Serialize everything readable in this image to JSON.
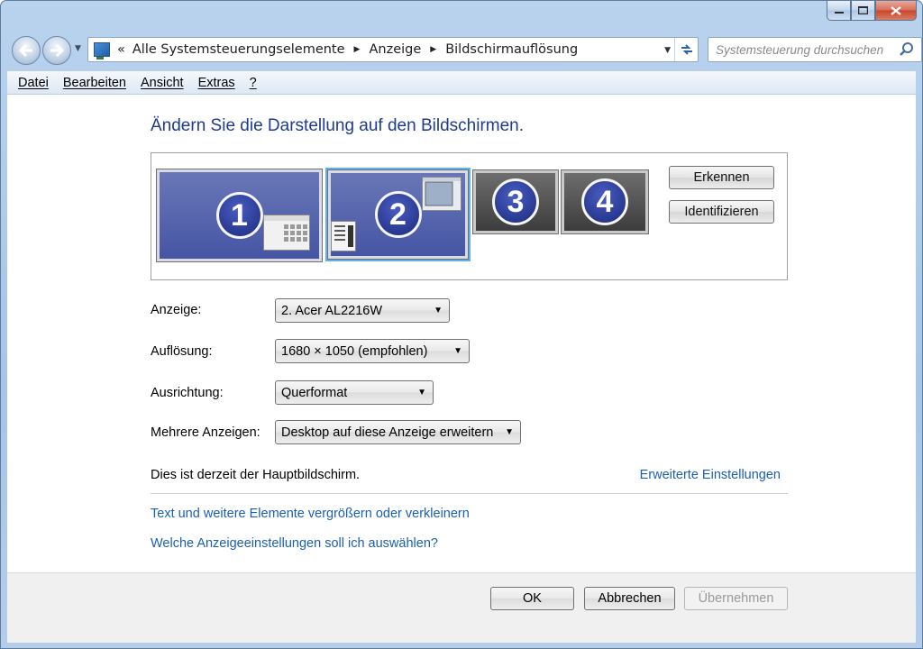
{
  "window": {
    "caption_buttons": [
      "minimize-icon",
      "maximize-icon",
      "close-icon"
    ]
  },
  "nav": {
    "breadcrumb_prefix": "«",
    "breadcrumb": [
      "Alle Systemsteuerungselemente",
      "Anzeige",
      "Bildschirmauflösung"
    ],
    "search_placeholder": "Systemsteuerung durchsuchen"
  },
  "menu": [
    "Datei",
    "Bearbeiten",
    "Ansicht",
    "Extras",
    "?"
  ],
  "main": {
    "heading": "Ändern Sie die Darstellung auf den Bildschirmen.",
    "monitors": [
      {
        "number": "1",
        "state": "active"
      },
      {
        "number": "2",
        "state": "selected"
      },
      {
        "number": "3",
        "state": "inactive"
      },
      {
        "number": "4",
        "state": "inactive"
      }
    ],
    "detect_button": "Erkennen",
    "identify_button": "Identifizieren",
    "fields": {
      "display_label": "Anzeige:",
      "display_value": "2. Acer AL2216W",
      "resolution_label": "Auflösung:",
      "resolution_value": "1680 × 1050 (empfohlen)",
      "orientation_label": "Ausrichtung:",
      "orientation_value": "Querformat",
      "multi_label": "Mehrere Anzeigen:",
      "multi_value": "Desktop auf diese Anzeige erweitern"
    },
    "status_text": "Dies ist derzeit der Hauptbildschirm.",
    "advanced_link": "Erweiterte Einstellungen",
    "link_text_size": "Text und weitere Elemente vergrößern oder verkleinern",
    "link_which_settings": "Welche Anzeigeeinstellungen soll ich auswählen?"
  },
  "footer": {
    "ok": "OK",
    "cancel": "Abbrechen",
    "apply": "Übernehmen"
  },
  "colors": {
    "heading": "#1e3b8e",
    "link": "#1a5fb4",
    "monitor_active": "#4554a3",
    "selection": "#5fb0ef"
  }
}
